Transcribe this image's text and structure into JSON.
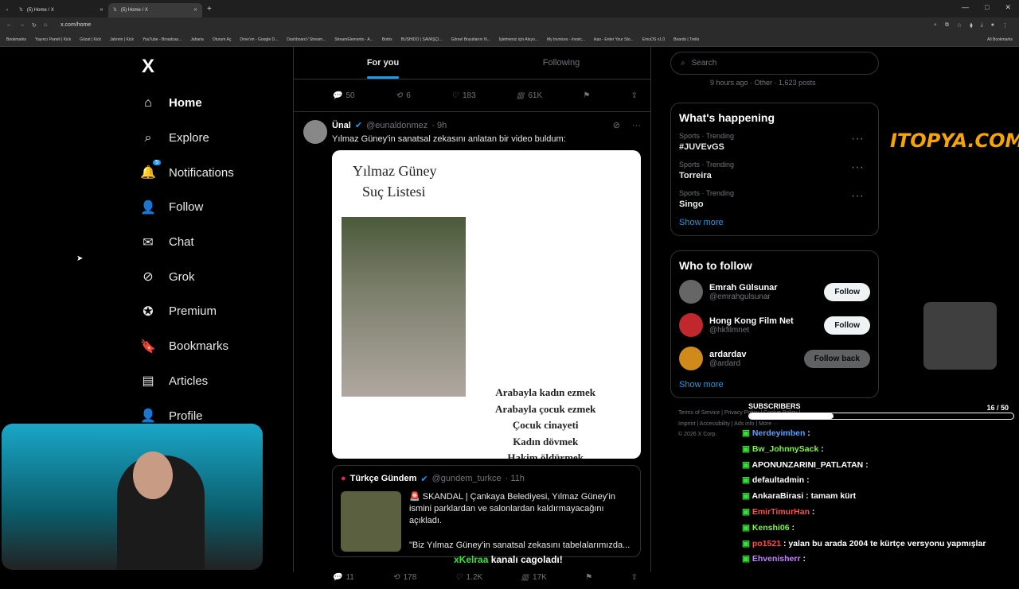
{
  "tabs": [
    {
      "title": "(5) Home / X"
    },
    {
      "title": "(5) Home / X"
    }
  ],
  "url": "x.com/home",
  "bookmarks": [
    "Bookmarks",
    "Yayıncı Paneli | Kick",
    "Gözat | Kick",
    "Jahrein | Kick",
    "YouTube - Broadcas...",
    "Jaharia",
    "Oturum Aç",
    "Drive'ım - Google D...",
    "Dashboard / Stream...",
    "StreamElements - A...",
    "Botrix",
    "BUSHIDO | SAVAŞÇI...",
    "Görsel Boyutlarını N...",
    "İşletmeniz için Akıyo...",
    "My Invoices - Invoic...",
    "ikas - Enter Your Sto...",
    "EmuOS v1.0",
    "Boards | Trello"
  ],
  "bookmarks_all": "All Bookmarks",
  "nav": {
    "logo": "X",
    "items": [
      {
        "label": "Home",
        "icon": "home-icon",
        "glyph": "⌂"
      },
      {
        "label": "Explore",
        "icon": "search-icon",
        "glyph": "⌕"
      },
      {
        "label": "Notifications",
        "icon": "bell-icon",
        "glyph": "🔔"
      },
      {
        "label": "Follow",
        "icon": "add-person-icon",
        "glyph": "👤"
      },
      {
        "label": "Chat",
        "icon": "mail-icon",
        "glyph": "✉"
      },
      {
        "label": "Grok",
        "icon": "grok-icon",
        "glyph": "⊘"
      },
      {
        "label": "Premium",
        "icon": "verified-icon",
        "glyph": "✪"
      },
      {
        "label": "Bookmarks",
        "icon": "bookmark-icon",
        "glyph": "🔖"
      },
      {
        "label": "Articles",
        "icon": "article-icon",
        "glyph": "▤"
      },
      {
        "label": "Profile",
        "icon": "person-icon",
        "glyph": "👤"
      }
    ],
    "notification_badge": "5"
  },
  "feed": {
    "tab_for_you": "For you",
    "tab_following": "Following",
    "prev_actions": {
      "replies": "50",
      "reposts": "6",
      "likes": "183",
      "views": "61K"
    },
    "post": {
      "name": "Ünal",
      "handle": "@eunaldonmez",
      "time": "· 9h",
      "text": "Yılmaz Güney'in sanatsal zekasını anlatan bir video buldum:",
      "media_title1": "Yılmaz Güney",
      "media_title2": "Suç Listesi",
      "media_crimes": [
        "Arabayla kadın ezmek",
        "Arabayla çocuk ezmek",
        "Çocuk cinayeti",
        "Kadın dövmek",
        "Hakim öldürmek"
      ]
    },
    "quote": {
      "name": "Türkçe Gündem",
      "handle": "@gundem_turkce",
      "time": "· 11h",
      "text": "🚨 SKANDAL | Çankaya Belediyesi, Yılmaz Güney'in ismini parklardan ve salonlardan kaldırmayacağını açıkladı.",
      "text2": "\"Biz Yılmaz Güney'in sanatsal zekasını tabelalarımızda..."
    },
    "post_actions": {
      "replies": "11",
      "reposts": "178",
      "likes": "1.2K",
      "views": "17K"
    }
  },
  "sidebar": {
    "search_placeholder": "Search",
    "live_meta": "9 hours ago · Other · 1,623 posts",
    "happening_title": "What's happening",
    "trends": [
      {
        "category": "Sports · Trending",
        "name": "#JUVEvGS"
      },
      {
        "category": "Sports · Trending",
        "name": "Torreira"
      },
      {
        "category": "Sports · Trending",
        "name": "Singo"
      }
    ],
    "show_more": "Show more",
    "who_title": "Who to follow",
    "who": [
      {
        "name": "Emrah Gülsunar",
        "handle": "@emrahgulsunar",
        "button": "Follow"
      },
      {
        "name": "Hong Kong Film Net",
        "handle": "@hkfilmnet",
        "button": "Follow"
      },
      {
        "name": "ardardav",
        "handle": "@ardard",
        "button": "Follow back"
      }
    ],
    "who_show_more": "Show more",
    "footer1": "Terms of Service  |  Privacy Policy  |  Cookie Policy  |",
    "footer2": "Imprint  |  Accessibility  |  Ads info  |  More ···",
    "footer3": "© 2026 X Corp."
  },
  "overlay": {
    "brand": "ITOPYA.COM",
    "subs_label": "SUBSCRIBERS",
    "subs_count": "16 / 50",
    "subs_progress": 0.32,
    "chat": [
      {
        "user": "Nerdeyimben",
        "color": "#5aa0ff",
        "msg": ":"
      },
      {
        "user": "Bw_JohnnySack",
        "color": "#7ef542",
        "msg": ":"
      },
      {
        "user": "APONUNZARINI_PATLATAN",
        "color": "#ffffff",
        "msg": ":"
      },
      {
        "user": "defaultadmin",
        "color": "#ffffff",
        "msg": ":"
      },
      {
        "user": "AnkaraBirasi",
        "color": "#ffffff",
        "msg": ": tamam kürt"
      },
      {
        "user": "EmirTimurHan",
        "color": "#ff4d4d",
        "msg": ":"
      },
      {
        "user": "Kenshi06",
        "color": "#7ef542",
        "msg": ":"
      },
      {
        "user": "po1521",
        "color": "#ff4d4d",
        "msg": ": yalan bu arada 2004 te kürtçe versyonu yapmışlar"
      },
      {
        "user": "Ehvenisherr",
        "color": "#c084fc",
        "msg": ":"
      }
    ],
    "banner_user": "xKelraa",
    "banner_text": " kanalı cagoladı!"
  }
}
